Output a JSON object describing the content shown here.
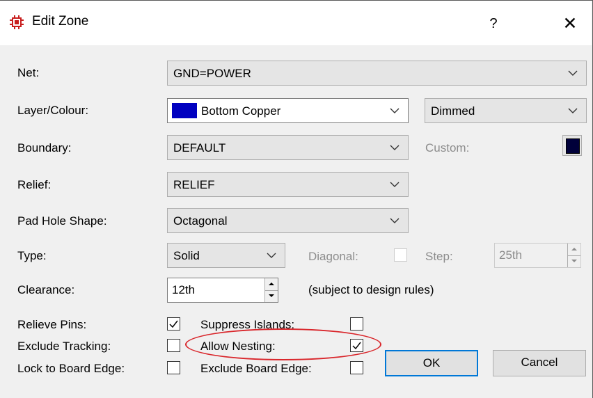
{
  "window": {
    "title": "Edit Zone",
    "help": "?",
    "close": "✕"
  },
  "net": {
    "label": "Net:",
    "value": "GND=POWER"
  },
  "layer": {
    "label": "Layer/Colour:",
    "value": "Bottom Copper",
    "swatch_color": "#0000c0",
    "mode": "Dimmed"
  },
  "boundary": {
    "label": "Boundary:",
    "value": "DEFAULT",
    "custom_label": "Custom:",
    "custom_color": "#00003a"
  },
  "relief": {
    "label": "Relief:",
    "value": "RELIEF"
  },
  "pad_hole": {
    "label": "Pad Hole Shape:",
    "value": "Octagonal"
  },
  "type": {
    "label": "Type:",
    "value": "Solid",
    "diagonal_label": "Diagonal:",
    "step_label": "Step:",
    "step_value": "25th"
  },
  "clearance": {
    "label": "Clearance:",
    "value": "12th",
    "note": "(subject to design rules)"
  },
  "options": {
    "relieve_pins": {
      "label": "Relieve Pins:",
      "checked": true
    },
    "suppress_islands": {
      "label": "Suppress Islands:",
      "checked": false
    },
    "exclude_tracking": {
      "label": "Exclude Tracking:",
      "checked": false
    },
    "allow_nesting": {
      "label": "Allow Nesting:",
      "checked": true
    },
    "lock_board_edge": {
      "label": "Lock to Board Edge:",
      "checked": false
    },
    "exclude_board_edge": {
      "label": "Exclude Board Edge:",
      "checked": false
    }
  },
  "buttons": {
    "ok": "OK",
    "cancel": "Cancel"
  },
  "annotation": {
    "color": "#d9262b"
  }
}
